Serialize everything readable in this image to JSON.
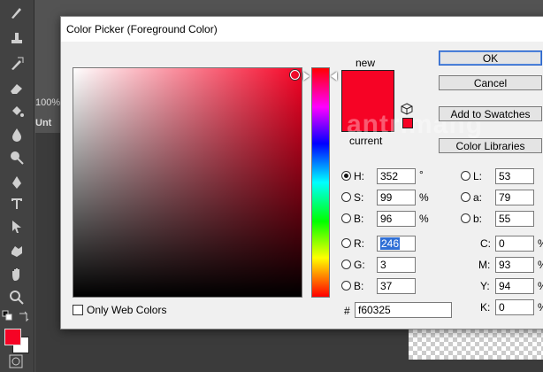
{
  "app": {
    "zoom": "100%",
    "doc_tab": "Unt",
    "foreground_color": "#f60325",
    "background_color": "#ffffff"
  },
  "dialog": {
    "title": "Color Picker (Foreground Color)",
    "new_label": "new",
    "current_label": "current",
    "selected_color": "#f60325",
    "buttons": {
      "ok": "OK",
      "cancel": "Cancel",
      "add_to_swatches": "Add to Swatches",
      "color_libraries": "Color Libraries"
    },
    "hsb": {
      "h": {
        "label": "H:",
        "value": "352",
        "unit": "°"
      },
      "s": {
        "label": "S:",
        "value": "99",
        "unit": "%"
      },
      "b": {
        "label": "B:",
        "value": "96",
        "unit": "%"
      }
    },
    "rgb": {
      "r": {
        "label": "R:",
        "value": "246"
      },
      "g": {
        "label": "G:",
        "value": "3"
      },
      "b": {
        "label": "B:",
        "value": "37"
      }
    },
    "lab": {
      "l": {
        "label": "L:",
        "value": "53"
      },
      "a": {
        "label": "a:",
        "value": "79"
      },
      "b": {
        "label": "b:",
        "value": "55"
      }
    },
    "cmyk": {
      "c": {
        "label": "C:",
        "value": "0",
        "unit": "%"
      },
      "m": {
        "label": "M:",
        "value": "93",
        "unit": "%"
      },
      "y": {
        "label": "Y:",
        "value": "94",
        "unit": "%"
      },
      "k": {
        "label": "K:",
        "value": "0",
        "unit": "%"
      }
    },
    "hex": {
      "label": "#",
      "value": "f60325"
    },
    "only_web_colors": "Only Web Colors",
    "watermark": "antrimang"
  }
}
